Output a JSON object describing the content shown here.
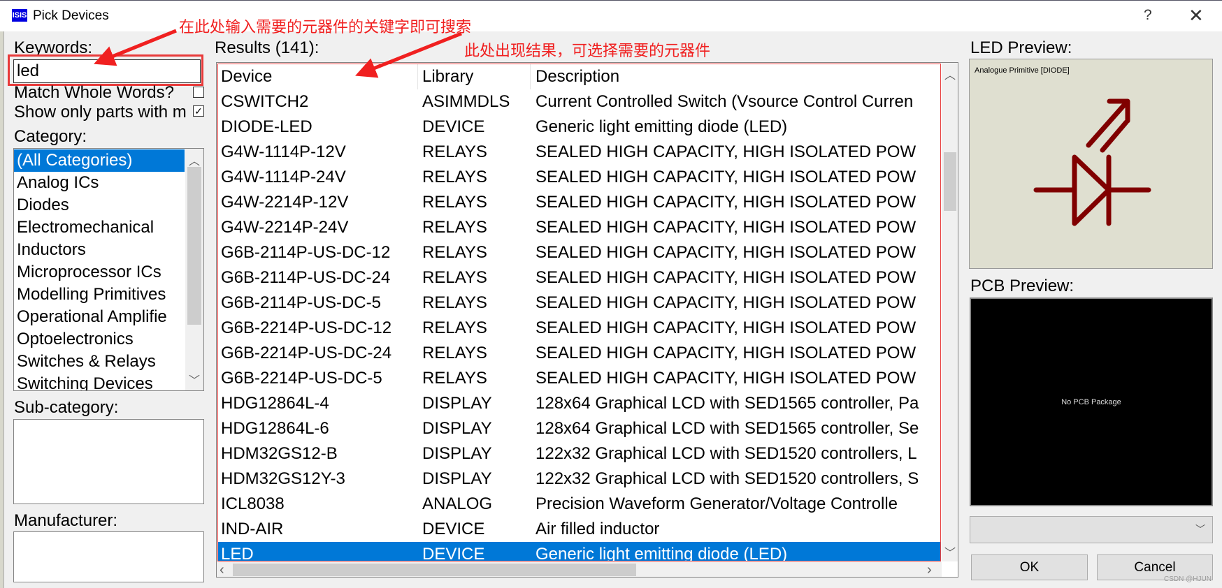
{
  "window": {
    "title": "Pick Devices",
    "logo_text": "ISIS",
    "help": "?",
    "close": "✕"
  },
  "keywords": {
    "label": "Keywords:",
    "value": "led"
  },
  "options": {
    "match_whole_words": {
      "label": "Match Whole Words?",
      "checked": false
    },
    "show_only_parts": {
      "label": "Show only parts with m",
      "checked": true,
      "mark": "✓"
    }
  },
  "category": {
    "label": "Category:",
    "items": [
      "(All Categories)",
      "Analog ICs",
      "Diodes",
      "Electromechanical",
      "Inductors",
      "Microprocessor ICs",
      "Modelling Primitives",
      "Operational Amplifie",
      "Optoelectronics",
      "Switches & Relays",
      "Switching Devices"
    ],
    "selected": 0
  },
  "subcategory": {
    "label": "Sub-category:"
  },
  "manufacturer": {
    "label": "Manufacturer:"
  },
  "results": {
    "label": "Results (141):",
    "columns": [
      "Device",
      "Library",
      "Description"
    ],
    "rows": [
      [
        "CSWITCH2",
        "ASIMMDLS",
        "Current Controlled Switch (Vsource Control Curren"
      ],
      [
        "DIODE-LED",
        "DEVICE",
        "Generic light emitting diode (LED)"
      ],
      [
        "G4W-1114P-12V",
        "RELAYS",
        "SEALED HIGH CAPACITY, HIGH ISOLATED POW"
      ],
      [
        "G4W-1114P-24V",
        "RELAYS",
        "SEALED HIGH CAPACITY, HIGH ISOLATED POW"
      ],
      [
        "G4W-2214P-12V",
        "RELAYS",
        "SEALED HIGH CAPACITY, HIGH ISOLATED POW"
      ],
      [
        "G4W-2214P-24V",
        "RELAYS",
        "SEALED HIGH CAPACITY, HIGH ISOLATED POW"
      ],
      [
        "G6B-2114P-US-DC-12",
        "RELAYS",
        "SEALED HIGH CAPACITY, HIGH ISOLATED POW"
      ],
      [
        "G6B-2114P-US-DC-24",
        "RELAYS",
        "SEALED HIGH CAPACITY, HIGH ISOLATED POW"
      ],
      [
        "G6B-2114P-US-DC-5",
        "RELAYS",
        "SEALED HIGH CAPACITY, HIGH ISOLATED POW"
      ],
      [
        "G6B-2214P-US-DC-12",
        "RELAYS",
        "SEALED HIGH CAPACITY, HIGH ISOLATED POW"
      ],
      [
        "G6B-2214P-US-DC-24",
        "RELAYS",
        "SEALED HIGH CAPACITY, HIGH ISOLATED POW"
      ],
      [
        "G6B-2214P-US-DC-5",
        "RELAYS",
        "SEALED HIGH CAPACITY, HIGH ISOLATED POW"
      ],
      [
        "HDG12864L-4",
        "DISPLAY",
        "128x64 Graphical LCD with SED1565 controller, Pa"
      ],
      [
        "HDG12864L-6",
        "DISPLAY",
        "128x64 Graphical LCD with SED1565 controller, Se"
      ],
      [
        "HDM32GS12-B",
        "DISPLAY",
        "122x32 Graphical LCD with SED1520 controllers, L"
      ],
      [
        "HDM32GS12Y-3",
        "DISPLAY",
        "122x32 Graphical LCD with SED1520 controllers, S"
      ],
      [
        "ICL8038",
        "ANALOG",
        "Precision Waveform Generator/Voltage Controlle"
      ],
      [
        "IND-AIR",
        "DEVICE",
        "Air filled inductor"
      ],
      [
        "LED",
        "DEVICE",
        "Generic light emitting diode (LED)"
      ]
    ],
    "selected": 18
  },
  "led_preview": {
    "label": "LED Preview:",
    "caption": "Analogue Primitive [DIODE]",
    "symbol_color": "#800000"
  },
  "pcb_preview": {
    "label": "PCB Preview:",
    "message": "No PCB Package"
  },
  "package_select": {
    "value": ""
  },
  "buttons": {
    "ok": "OK",
    "cancel": "Cancel"
  },
  "annotations": {
    "keyword_hint": "在此处输入需要的元器件的关键字即可搜索",
    "results_hint": "此处出现结果，可选择需要的元器件",
    "color": "#f02020"
  },
  "watermark": "CSDN @HJUN"
}
